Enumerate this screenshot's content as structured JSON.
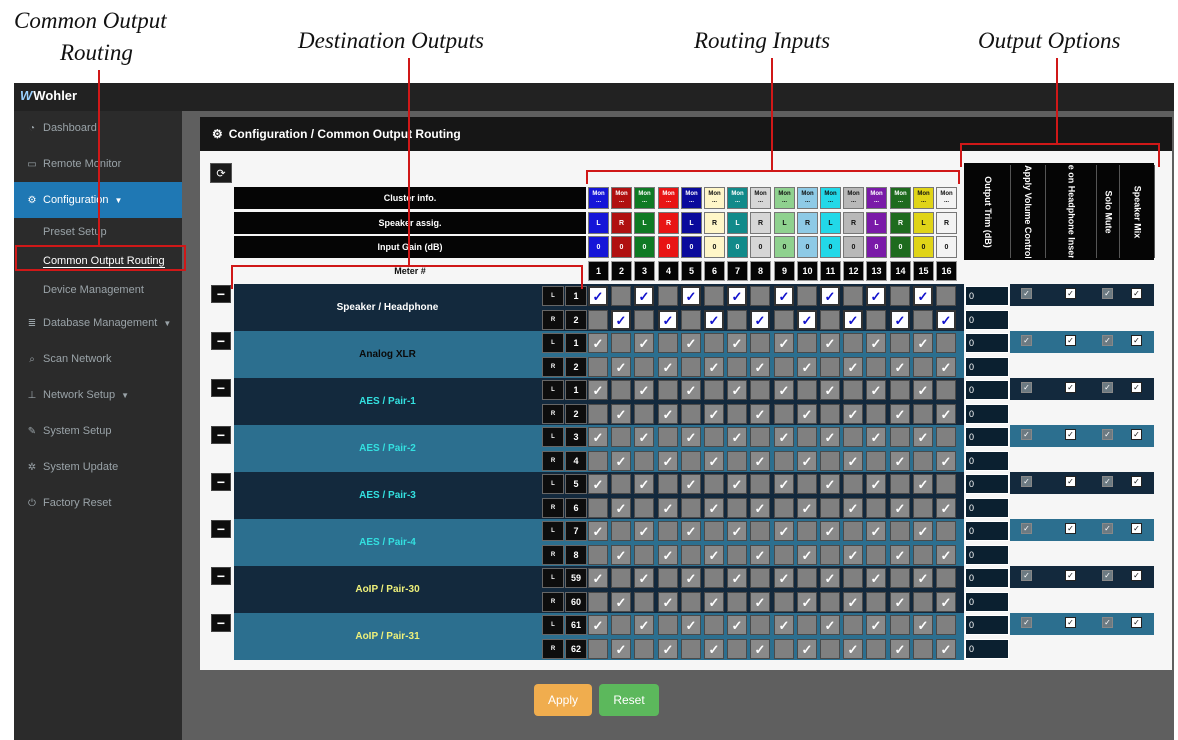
{
  "annotations": {
    "common_output_routing": [
      "Common Output",
      "Routing"
    ],
    "destination_outputs": "Destination Outputs",
    "routing_inputs": "Routing Inputs",
    "output_options": "Output Options"
  },
  "colors": {
    "annotation_red": "#d01818",
    "sidebar_active": "#1f78b4",
    "apply": "#f0ad4e",
    "reset": "#5cb85c"
  },
  "app": {
    "logo": "Wohler"
  },
  "sidebar": {
    "items": [
      {
        "label": "Dashboard",
        "icon": "dashboard-icon"
      },
      {
        "label": "Remote Monitor",
        "icon": "monitor-icon"
      },
      {
        "label": "Configuration",
        "icon": "gears-icon"
      },
      {
        "label": "Database Management",
        "icon": "database-icon"
      },
      {
        "label": "Scan Network",
        "icon": "search-icon"
      },
      {
        "label": "Network Setup",
        "icon": "sitemap-icon"
      },
      {
        "label": "System Setup",
        "icon": "wrench-icon"
      },
      {
        "label": "System Update",
        "icon": "gear-icon"
      },
      {
        "label": "Factory Reset",
        "icon": "power-icon"
      }
    ],
    "config_subitems": [
      "Preset Setup",
      "Common Output Routing",
      "Device Management"
    ]
  },
  "panel": {
    "title": "Configuration / Common Output Routing"
  },
  "row_labels": {
    "cluster": "Cluster info.",
    "speaker": "Speaker assig.",
    "gain": "Input Gain (dB)",
    "meter": "Meter #"
  },
  "inputs": [
    {
      "meter": "1",
      "cluster": "Mon",
      "speaker": "L",
      "gain": "0",
      "color": "#1515d8",
      "text": "#ffffff"
    },
    {
      "meter": "2",
      "cluster": "Mon",
      "speaker": "R",
      "gain": "0",
      "color": "#b01010",
      "text": "#ffffff"
    },
    {
      "meter": "3",
      "cluster": "Mon",
      "speaker": "L",
      "gain": "0",
      "color": "#0f7a24",
      "text": "#ffffff"
    },
    {
      "meter": "4",
      "cluster": "Mon",
      "speaker": "R",
      "gain": "0",
      "color": "#e81414",
      "text": "#ffffff"
    },
    {
      "meter": "5",
      "cluster": "Mon",
      "speaker": "L",
      "gain": "0",
      "color": "#0a0a9c",
      "text": "#ffffff"
    },
    {
      "meter": "6",
      "cluster": "Mon",
      "speaker": "R",
      "gain": "0",
      "color": "#fff6c8",
      "text": "#111111"
    },
    {
      "meter": "7",
      "cluster": "Mon",
      "speaker": "L",
      "gain": "0",
      "color": "#118a8a",
      "text": "#ffffff"
    },
    {
      "meter": "8",
      "cluster": "Mon",
      "speaker": "R",
      "gain": "0",
      "color": "#d6d6d6",
      "text": "#111111"
    },
    {
      "meter": "9",
      "cluster": "Mon",
      "speaker": "L",
      "gain": "0",
      "color": "#8fd18f",
      "text": "#111111"
    },
    {
      "meter": "10",
      "cluster": "Mon",
      "speaker": "R",
      "gain": "0",
      "color": "#8ecae6",
      "text": "#111111"
    },
    {
      "meter": "11",
      "cluster": "Mon",
      "speaker": "L",
      "gain": "0",
      "color": "#22d8e8",
      "text": "#111111"
    },
    {
      "meter": "12",
      "cluster": "Mon",
      "speaker": "R",
      "gain": "0",
      "color": "#b8b8b8",
      "text": "#111111"
    },
    {
      "meter": "13",
      "cluster": "Mon",
      "speaker": "L",
      "gain": "0",
      "color": "#7a1aa8",
      "text": "#ffffff"
    },
    {
      "meter": "14",
      "cluster": "Mon",
      "speaker": "R",
      "gain": "0",
      "color": "#1e6b1e",
      "text": "#ffffff"
    },
    {
      "meter": "15",
      "cluster": "Mon",
      "speaker": "L",
      "gain": "0",
      "color": "#e0d418",
      "text": "#111111"
    },
    {
      "meter": "16",
      "cluster": "Mon",
      "speaker": "R",
      "gain": "0",
      "color": "#f3f3f3",
      "text": "#111111"
    }
  ],
  "output_option_headers": [
    "Output Trim (dB)",
    "Apply Volume Control",
    "Mute on Headphone Insertion",
    "Solo Mute",
    "Speaker Mix"
  ],
  "outputs": [
    {
      "name": "Speaker / Headphone",
      "name_color": "#ffffff",
      "bg": "#13293d",
      "ch_l": "1",
      "ch_r": "2",
      "trim_l": "0",
      "trim_r": "0",
      "opts": [
        true,
        true,
        true,
        true
      ]
    },
    {
      "name": "Analog XLR",
      "name_color": "#0a0a0a",
      "bg": "#2c6f8f",
      "ch_l": "1",
      "ch_r": "2",
      "trim_l": "0",
      "trim_r": "0",
      "opts": [
        true,
        true,
        true,
        true
      ]
    },
    {
      "name": "AES / Pair-1",
      "name_color": "#33e0e0",
      "bg": "#13293d",
      "ch_l": "1",
      "ch_r": "2",
      "trim_l": "0",
      "trim_r": "0",
      "opts": [
        true,
        true,
        true,
        true
      ]
    },
    {
      "name": "AES / Pair-2",
      "name_color": "#33e0e0",
      "bg": "#2c6f8f",
      "ch_l": "3",
      "ch_r": "4",
      "trim_l": "0",
      "trim_r": "0",
      "opts": [
        true,
        true,
        true,
        true
      ]
    },
    {
      "name": "AES / Pair-3",
      "name_color": "#33e0e0",
      "bg": "#13293d",
      "ch_l": "5",
      "ch_r": "6",
      "trim_l": "0",
      "trim_r": "0",
      "opts": [
        true,
        true,
        true,
        true
      ]
    },
    {
      "name": "AES / Pair-4",
      "name_color": "#33e0e0",
      "bg": "#2c6f8f",
      "ch_l": "7",
      "ch_r": "8",
      "trim_l": "0",
      "trim_r": "0",
      "opts": [
        true,
        true,
        true,
        true
      ]
    },
    {
      "name": "AoIP / Pair-30",
      "name_color": "#eef07a",
      "bg": "#13293d",
      "ch_l": "59",
      "ch_r": "60",
      "trim_l": "0",
      "trim_r": "0",
      "opts": [
        true,
        true,
        true,
        true
      ]
    },
    {
      "name": "AoIP / Pair-31",
      "name_color": "#eef07a",
      "bg": "#2c6f8f",
      "ch_l": "61",
      "ch_r": "62",
      "trim_l": "0",
      "trim_r": "0",
      "opts": [
        true,
        true,
        true,
        true
      ]
    }
  ],
  "side_labels": {
    "left": "L",
    "right": "R"
  },
  "minus_symbol": "−",
  "check_mark": "✓",
  "buttons": {
    "apply": "Apply",
    "reset": "Reset"
  }
}
